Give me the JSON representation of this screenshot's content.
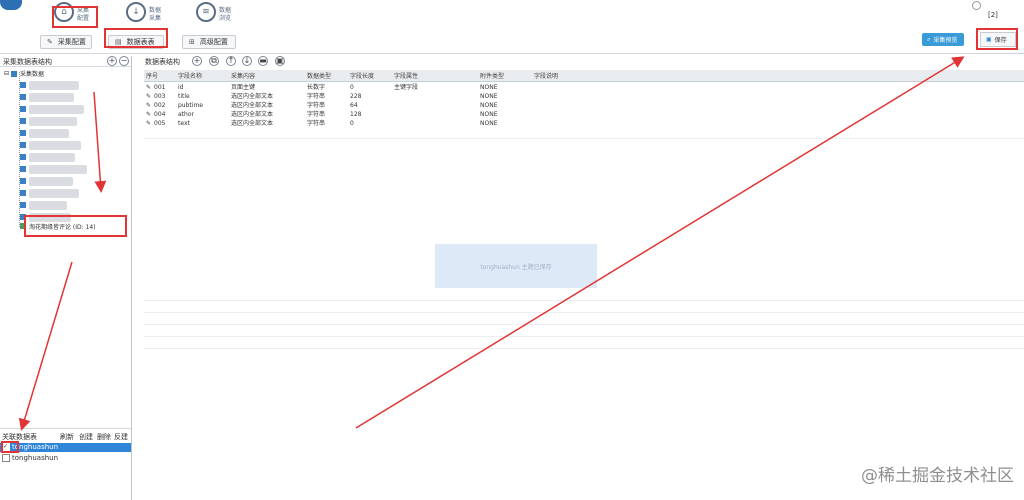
{
  "nav": {
    "items": [
      {
        "label_top": "采集",
        "label_bottom": "配置",
        "icon": "home-icon",
        "glyph": "⌂"
      },
      {
        "label_top": "数据",
        "label_bottom": "采集",
        "icon": "download-icon",
        "glyph": "↓"
      },
      {
        "label_top": "数据",
        "label_bottom": "浏览",
        "icon": "layers-icon",
        "glyph": "≋"
      }
    ],
    "corner_badge": "[2]"
  },
  "toolbar": {
    "buttons": [
      {
        "label": "采集配置",
        "icon": "edit-icon",
        "glyph": "✎"
      },
      {
        "label": "数据表表",
        "icon": "document-icon",
        "glyph": "▤"
      },
      {
        "label": "高级配置",
        "icon": "grid-icon",
        "glyph": "⊞"
      }
    ],
    "preview_label": "采集预览",
    "save_label": "保存"
  },
  "left_panel": {
    "title": "采集数据表结构",
    "root_label": "采集数据",
    "selected_item": "淘花期缘皆评论 (ID: 14)"
  },
  "main": {
    "title": "数据表结构",
    "columns": [
      "序号",
      "字段名称",
      "采集内容",
      "数据类型",
      "字段长度",
      "字段属性",
      "附件类型",
      "字段说明"
    ],
    "rows": [
      [
        "001",
        "id",
        "页面主键",
        "长数字",
        "0",
        "主键字段",
        "NONE",
        ""
      ],
      [
        "003",
        "title",
        "选区内全部文本",
        "字符串",
        "228",
        "",
        "NONE",
        ""
      ],
      [
        "002",
        "pubtime",
        "选区内全部文本",
        "字符串",
        "64",
        "",
        "NONE",
        ""
      ],
      [
        "004",
        "athor",
        "选区内全部文本",
        "字符串",
        "128",
        "",
        "NONE",
        ""
      ],
      [
        "005",
        "text",
        "选区内全部文本",
        "字符串",
        "0",
        "",
        "NONE",
        ""
      ]
    ],
    "toast_text": "tonghuashun 主题已保存"
  },
  "related": {
    "title": "关联数据表",
    "actions": [
      "刷新",
      "创建",
      "删除",
      "反建"
    ],
    "items": [
      "tonghuashun",
      "tonghuashun"
    ]
  },
  "watermark": "@稀土掘金技术社区",
  "colors": {
    "annotation_red": "#e23434",
    "selection_blue": "#2f86d9",
    "accent_blue": "#3a9bd8"
  }
}
